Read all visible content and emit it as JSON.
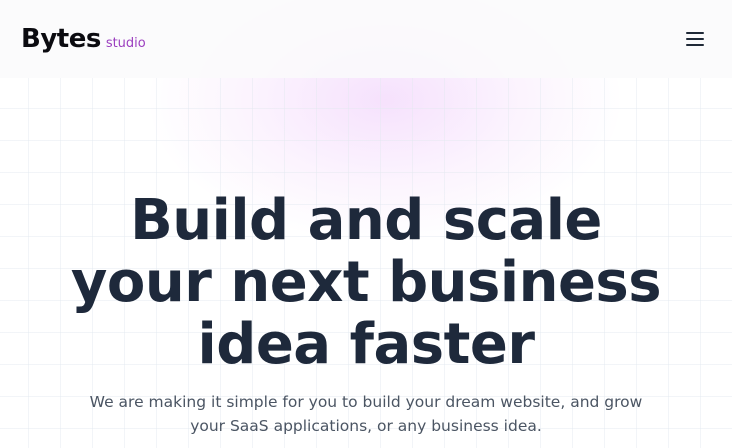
{
  "header": {
    "brand_name": "Bytes",
    "brand_suffix": "studio",
    "menu_icon": "hamburger-menu-icon"
  },
  "hero": {
    "title": "Build and scale your next business idea faster",
    "subtitle": "We are making it simple for you to build your dream website, and grow your SaaS applications, or any business idea."
  },
  "colors": {
    "brand_suffix": "#9b3fbf",
    "heading": "#1e293b",
    "body_text": "#4b5563",
    "glow": "#f4dcfc"
  }
}
